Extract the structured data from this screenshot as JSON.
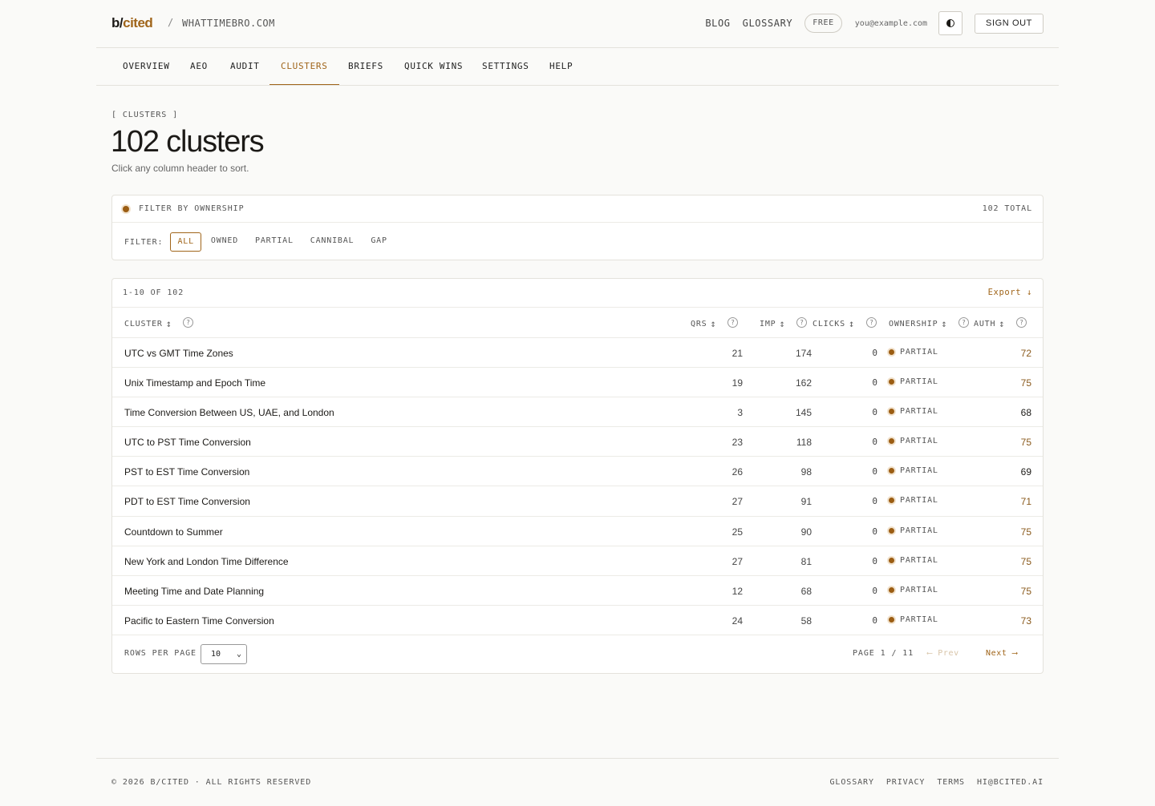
{
  "header": {
    "brand_b": "b/",
    "brand_cited": "cited",
    "sep": "/",
    "site": "WHATTIMEBRO.COM",
    "blog": "BLOG",
    "glossary": "GLOSSARY",
    "plan": "FREE",
    "email": "you@example.com",
    "signout": "SIGN OUT"
  },
  "nav": {
    "tabs": [
      "OVERVIEW",
      "AEO",
      "AUDIT",
      "CLUSTERS",
      "BRIEFS",
      "QUICK WINS",
      "SETTINGS",
      "HELP"
    ],
    "active": "CLUSTERS"
  },
  "page": {
    "eyebrow": "[ CLUSTERS ]",
    "title": "102 clusters",
    "subtitle": "Click any column header to sort."
  },
  "filter": {
    "heading": "FILTER BY OWNERSHIP",
    "total": "102 TOTAL",
    "label": "FILTER:",
    "options": [
      "ALL",
      "OWNED",
      "PARTIAL",
      "CANNIBAL",
      "GAP"
    ],
    "selected": "ALL"
  },
  "table": {
    "range": "1-10 OF 102",
    "export": "Export ↓",
    "columns": {
      "cluster": "CLUSTER",
      "qrs": "QRS",
      "imp": "IMP",
      "clicks": "CLICKS",
      "ownership": "OWNERSHIP",
      "auth": "AUTH"
    },
    "rows": [
      {
        "cluster": "UTC vs GMT Time Zones",
        "qrs": "21",
        "imp": "174",
        "clicks": "0",
        "ownership": "PARTIAL",
        "auth": "72"
      },
      {
        "cluster": "Unix Timestamp and Epoch Time",
        "qrs": "19",
        "imp": "162",
        "clicks": "0",
        "ownership": "PARTIAL",
        "auth": "75"
      },
      {
        "cluster": "Time Conversion Between US, UAE, and London",
        "qrs": "3",
        "imp": "145",
        "clicks": "0",
        "ownership": "PARTIAL",
        "auth": "68"
      },
      {
        "cluster": "UTC to PST Time Conversion",
        "qrs": "23",
        "imp": "118",
        "clicks": "0",
        "ownership": "PARTIAL",
        "auth": "75"
      },
      {
        "cluster": "PST to EST Time Conversion",
        "qrs": "26",
        "imp": "98",
        "clicks": "0",
        "ownership": "PARTIAL",
        "auth": "69"
      },
      {
        "cluster": "PDT to EST Time Conversion",
        "qrs": "27",
        "imp": "91",
        "clicks": "0",
        "ownership": "PARTIAL",
        "auth": "71"
      },
      {
        "cluster": "Countdown to Summer",
        "qrs": "25",
        "imp": "90",
        "clicks": "0",
        "ownership": "PARTIAL",
        "auth": "75"
      },
      {
        "cluster": "New York and London Time Difference",
        "qrs": "27",
        "imp": "81",
        "clicks": "0",
        "ownership": "PARTIAL",
        "auth": "75"
      },
      {
        "cluster": "Meeting Time and Date Planning",
        "qrs": "12",
        "imp": "68",
        "clicks": "0",
        "ownership": "PARTIAL",
        "auth": "75"
      },
      {
        "cluster": "Pacific to Eastern Time Conversion",
        "qrs": "24",
        "imp": "58",
        "clicks": "0",
        "ownership": "PARTIAL",
        "auth": "73"
      }
    ]
  },
  "pager": {
    "rows_per_page_label": "ROWS PER PAGE",
    "rows_per_page": "10",
    "page": "PAGE 1 / 11",
    "prev": "⟵ Prev",
    "next": "Next ⟶"
  },
  "footer": {
    "copyright": "© 2026 B/CITED · ALL RIGHTS RESERVED",
    "links": [
      "GLOSSARY",
      "PRIVACY",
      "TERMS",
      "HI@BCITED.AI"
    ]
  },
  "colors": {
    "accent": "#a0651a",
    "accent_dark": "#9b5d13",
    "auth_high": "#8a5a1c",
    "auth_low": "#1c1a17"
  }
}
